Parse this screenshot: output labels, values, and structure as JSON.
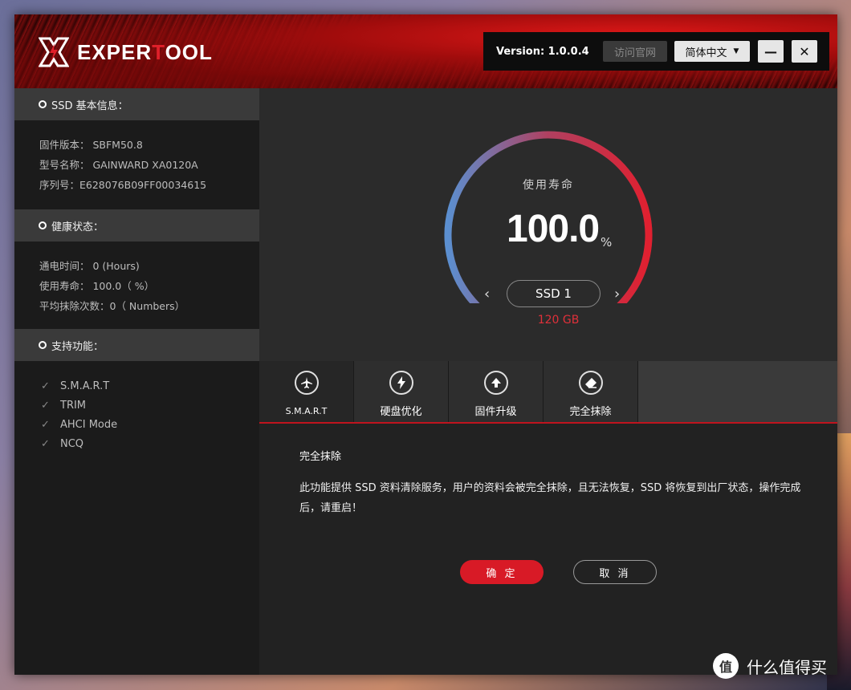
{
  "app": {
    "logo_prefix": "EXPER",
    "logo_highlight": "T",
    "logo_suffix": "OOL"
  },
  "topbar": {
    "version": "Version: 1.0.0.4",
    "visit_site": "访问官网",
    "language": "简体中文",
    "minimize": "—",
    "close": "✕"
  },
  "sidebar": {
    "ssd_info": {
      "title": "SSD 基本信息：",
      "rows": [
        "固件版本： SBFM50.8",
        "型号名称： GAINWARD XA0120A",
        "序列号：E628076B09FF00034615"
      ]
    },
    "health": {
      "title": "健康状态：",
      "rows": [
        "通电时间： 0 (Hours)",
        "使用寿命：  100.0（ %）",
        "平均抹除次数：0（ Numbers）"
      ]
    },
    "features": {
      "title": "支持功能：",
      "items": [
        "S.M.A.R.T",
        "TRIM",
        "AHCI Mode",
        "NCQ"
      ]
    }
  },
  "gauge": {
    "label": "使用寿命",
    "value": "100.0",
    "unit": "%",
    "fraction": 1.0,
    "colors": {
      "start": "#5b8fd0",
      "end": "#e02030"
    }
  },
  "drive": {
    "prev": "‹",
    "next": "›",
    "name": "SSD 1",
    "size": "120 GB"
  },
  "tabs": [
    {
      "label": "S.M.A.R.T",
      "icon": "airplane-icon"
    },
    {
      "label": "硬盘优化",
      "icon": "lightning-icon"
    },
    {
      "label": "固件升级",
      "icon": "upload-icon"
    },
    {
      "label": "完全抹除",
      "icon": "eraser-icon"
    }
  ],
  "content": {
    "title": "完全抹除",
    "text": "此功能提供 SSD 资料清除服务，用户的资料会被完全抹除，且无法恢复，SSD 将恢复到出厂状态，操作完成后，请重启！",
    "ok": "确 定",
    "cancel": "取 消"
  },
  "watermark": {
    "badge": "值",
    "text": "什么值得买"
  }
}
